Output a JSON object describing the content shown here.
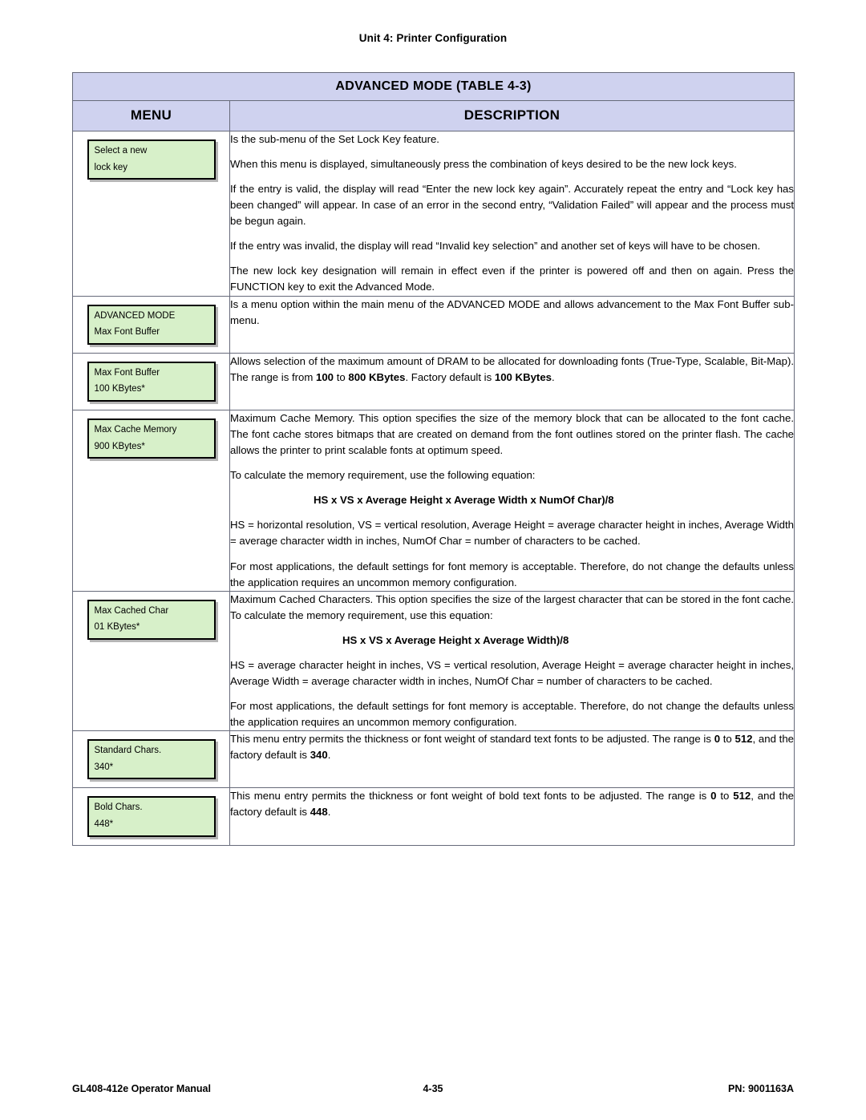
{
  "header": {
    "unit_title": "Unit 4:  Printer Configuration"
  },
  "table": {
    "title": "ADVANCED MODE (TABLE 4-3)",
    "col_menu": "MENU",
    "col_description": "DESCRIPTION"
  },
  "rows": [
    {
      "lcd_line1": "Select a new",
      "lcd_line2": "lock key",
      "paragraphs": [
        "Is the sub-menu of the Set Lock Key feature.",
        "When this menu is displayed, simultaneously press the combination of keys desired to be the new lock keys.",
        "If the entry is valid, the display will read “Enter the new lock key again”.  Accurately repeat the entry and “Lock key has been changed” will appear. In case of an error in the second entry, “Validation Failed” will appear and the process must be begun again.",
        "If the entry was invalid, the display will read “Invalid key selection” and another set of keys will have to be chosen.",
        "The new lock key designation will remain in effect even if the printer is powered off and then on again. Press the FUNCTION key to exit the Advanced Mode."
      ]
    },
    {
      "lcd_line1": "ADVANCED MODE",
      "lcd_line2": "Max Font Buffer",
      "paragraphs": [
        "Is a menu option within the main menu of the ADVANCED MODE and allows advancement to the Max Font Buffer sub-menu."
      ]
    },
    {
      "lcd_line1": "Max Font Buffer",
      "lcd_line2": "100 KBytes*",
      "paragraphs": [
        "Allows selection of the maximum amount of DRAM to be allocated for downloading fonts (True-Type, Scalable, Bit-Map). The range is from <b>100</b> to <b>800 KBytes</b>. Factory default is <b>100 KBytes</b>."
      ]
    },
    {
      "lcd_line1": "Max Cache Memory",
      "lcd_line2": "900 KBytes*",
      "paragraphs": [
        "Maximum Cache Memory. This option specifies the size of the memory block that can be allocated to the font cache. The font cache stores bitmaps that are created on demand from the font outlines stored on the printer flash. The cache allows the printer to print scalable fonts at optimum speed.",
        "To calculate the memory requirement, use the following equation:",
        "HS = horizontal resolution, VS = vertical resolution, Average Height = average character height in inches, Average Width = average character width in inches, NumOf Char = number of characters to be cached.",
        "For most applications, the default settings for font memory is acceptable. Therefore, do not change the defaults unless the application requires an uncommon memory configuration."
      ],
      "equation": "HS x VS x Average Height x Average Width x NumOf Char)/8"
    },
    {
      "lcd_line1": "Max Cached Char",
      "lcd_line2": "01 KBytes*",
      "paragraphs": [
        "Maximum Cached Characters. This option specifies the size of the largest character that can be stored in the font cache. To calculate the memory requirement, use this equation:",
        "HS = average character height in inches, VS = vertical resolution, Average Height = average character height in inches, Average Width = average character width in inches, NumOf Char = number of characters to be cached.",
        "For most applications, the default settings for font memory is acceptable. Therefore, do not change the defaults unless the application requires an uncommon memory configuration."
      ],
      "equation": "HS x VS x Average Height x Average Width)/8"
    },
    {
      "lcd_line1": "Standard Chars.",
      "lcd_line2": "340*",
      "paragraphs": [
        "This menu entry permits the thickness or font weight of standard text fonts to be adjusted. The range is <b>0</b> to <b>512</b>, and the factory default is <b>340</b>."
      ]
    },
    {
      "lcd_line1": "Bold Chars.",
      "lcd_line2": "448*",
      "paragraphs": [
        "This menu entry permits the thickness or font weight of bold text fonts to be adjusted. The range is <b>0</b> to <b>512</b>, and the factory default is <b>448</b>."
      ]
    }
  ],
  "footer": {
    "left": "GL408-412e Operator Manual",
    "center": "4-35",
    "right": "PN: 9001163A"
  },
  "colors": {
    "table_header_bg": "#cfd2ef",
    "lcd_bg": "#d7f0c9",
    "border": "#666a7a"
  }
}
